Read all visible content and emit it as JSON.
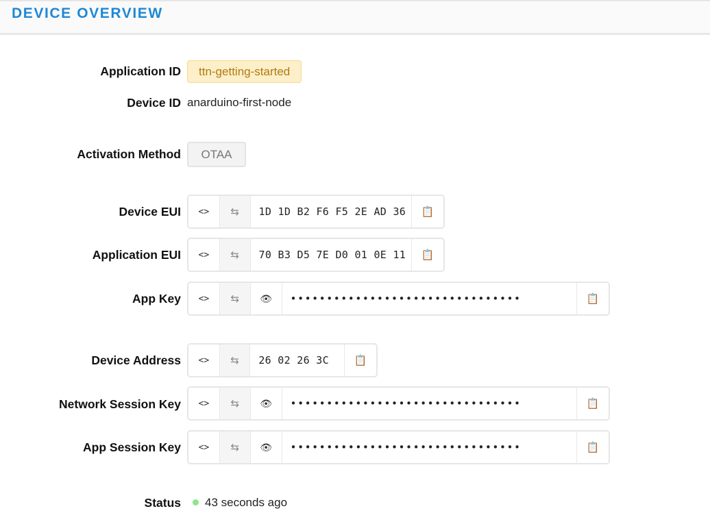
{
  "header": {
    "title": "DEVICE OVERVIEW"
  },
  "application": {
    "label": "Application ID",
    "value": "ttn-getting-started"
  },
  "device": {
    "label": "Device ID",
    "value": "anarduino-first-node"
  },
  "activation": {
    "label": "Activation Method",
    "value": "OTAA"
  },
  "fields": {
    "device_eui": {
      "label": "Device EUI",
      "value": "1D 1D B2 F6 F5 2E AD 36"
    },
    "app_eui": {
      "label": "Application EUI",
      "value": "70 B3 D5 7E D0 01 0E 11"
    },
    "app_key": {
      "label": "App Key",
      "value": "••••••••••••••••••••••••••••••••"
    },
    "device_address": {
      "label": "Device Address",
      "value": "26 02 26 3C"
    },
    "nwk_skey": {
      "label": "Network Session Key",
      "value": "••••••••••••••••••••••••••••••••"
    },
    "app_skey": {
      "label": "App Session Key",
      "value": "••••••••••••••••••••••••••••••••"
    }
  },
  "icons": {
    "code": "<>",
    "swap": "⇆",
    "eye": "👁",
    "copy": "📋"
  },
  "status": {
    "label": "Status",
    "value": "43 seconds ago",
    "dot_color": "#8ee58e"
  },
  "colors": {
    "accent": "#1e88d6",
    "app_badge_bg": "#fdefc9",
    "app_badge_text": "#b07a10"
  }
}
